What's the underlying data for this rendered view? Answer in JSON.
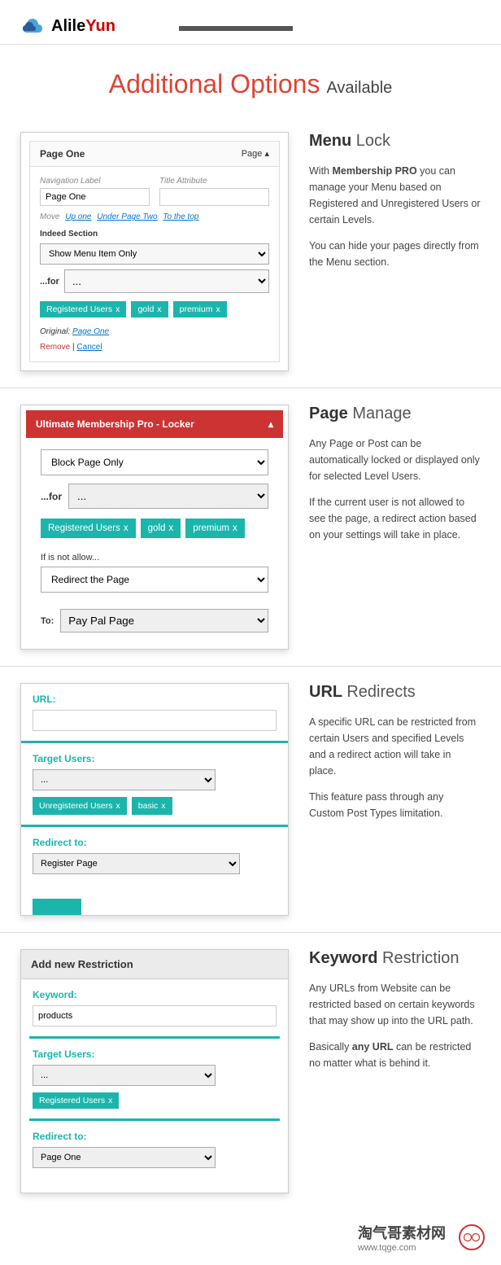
{
  "header": {
    "logo_text_1": "Alile",
    "logo_text_2": "Yun"
  },
  "main_title": {
    "primary": "Additional Options",
    "secondary": "Available"
  },
  "section1": {
    "panel_title": "Page One",
    "panel_type": "Page",
    "nav_label": "Navigation Label",
    "nav_value": "Page One",
    "title_attr": "Title Attribute",
    "move": "Move",
    "move_links": [
      "Up one",
      "Under Page Two",
      "To the top"
    ],
    "indeed_section": "Indeed Section",
    "show_option": "Show Menu Item Only",
    "for_label": "...for",
    "for_value": "...",
    "tags": [
      "Registered Users",
      "gold",
      "premium"
    ],
    "original_label": "Original:",
    "original_link": "Page One",
    "remove": "Remove",
    "cancel": "Cancel",
    "heading_bold": "Menu",
    "heading_light": "Lock",
    "desc1a": "With ",
    "desc1b": "Membership PRO",
    "desc1c": " you can manage your Menu based on Registered and Unregistered Users or certain Levels.",
    "desc2": "You can hide your pages directly from the Menu section."
  },
  "section2": {
    "locker_title": "Ultimate Membership Pro - Locker",
    "block_option": "Block Page Only",
    "for_label": "...for",
    "for_value": "...",
    "tags": [
      "Registered Users",
      "gold",
      "premium"
    ],
    "notallow": "If is not allow...",
    "redirect_option": "Redirect the Page",
    "to_label": "To:",
    "to_value": "Pay Pal Page",
    "heading_bold": "Page",
    "heading_light": "Manage",
    "desc1": "Any Page or Post can be automatically locked or displayed only for selected Level Users.",
    "desc2": "If the current user is not allowed to see the page, a redirect action based on your settings will take in place."
  },
  "section3": {
    "url_label": "URL:",
    "target_label": "Target Users:",
    "target_value": "...",
    "tags": [
      "Unregistered Users",
      "basic"
    ],
    "redirect_label": "Redirect to:",
    "redirect_value": "Register Page",
    "heading_bold": "URL",
    "heading_light": "Redirects",
    "desc1": "A specific URL can be restricted from certain Users and specified Levels and a redirect action will take in place.",
    "desc2": "This feature pass through any Custom Post Types limitation."
  },
  "section4": {
    "header": "Add new Restriction",
    "keyword_label": "Keyword:",
    "keyword_value": "products",
    "target_label": "Target Users:",
    "target_value": "...",
    "tags": [
      "Registered Users"
    ],
    "redirect_label": "Redirect to:",
    "redirect_value": "Page One",
    "heading_bold": "Keyword",
    "heading_light": "Restriction",
    "desc1": "Any URLs from Website can be restricted based on certain keywords that may show up into the URL path.",
    "desc2a": "Basically ",
    "desc2b": "any URL",
    "desc2c": " can be restricted no matter what is behind it."
  },
  "footer": {
    "brand": "淘气哥素材网",
    "url": "www.tqge.com"
  }
}
